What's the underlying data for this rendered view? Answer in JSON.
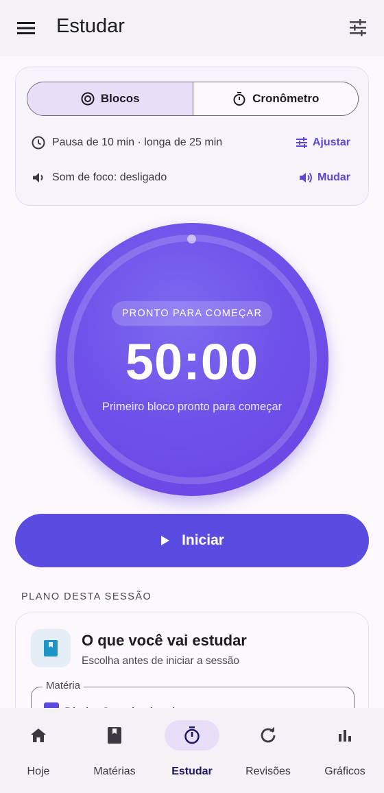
{
  "app_bar": {
    "title": "Estudar",
    "menu_icon": "menu-icon",
    "settings_icon": "tune-icon"
  },
  "mode": {
    "tabs": [
      {
        "label": "Blocos",
        "icon": "target-icon",
        "selected": true
      },
      {
        "label": "Cronômetro",
        "icon": "stopwatch-icon",
        "selected": false
      }
    ],
    "pause_text": "Pausa de 10 min · longa de 25 min",
    "pause_action": "Ajustar",
    "sound_text": "Som de foco: desligado",
    "sound_action": "Mudar"
  },
  "timer": {
    "status": "PRONTO PARA COMEÇAR",
    "time": "50:00",
    "subtitle": "Primeiro bloco pronto para começar",
    "progress": 0
  },
  "start_button": {
    "label": "Iniciar"
  },
  "plan": {
    "section_label": "PLANO DESTA SESSÃO",
    "title": "O que você vai estudar",
    "subtitle": "Escolha antes de iniciar a sessão",
    "field_label": "Matéria",
    "field_value": "Direito Constitucional"
  },
  "nav": {
    "items": [
      {
        "label": "Hoje",
        "icon": "home-icon"
      },
      {
        "label": "Matérias",
        "icon": "book-icon"
      },
      {
        "label": "Estudar",
        "icon": "timer-icon",
        "active": true
      },
      {
        "label": "Revisões",
        "icon": "refresh-icon"
      },
      {
        "label": "Gráficos",
        "icon": "bar-chart-icon"
      }
    ]
  },
  "colors": {
    "primary": "#5a4ce0",
    "timer": "#6f52ea",
    "selected_bg": "#e8def8"
  }
}
